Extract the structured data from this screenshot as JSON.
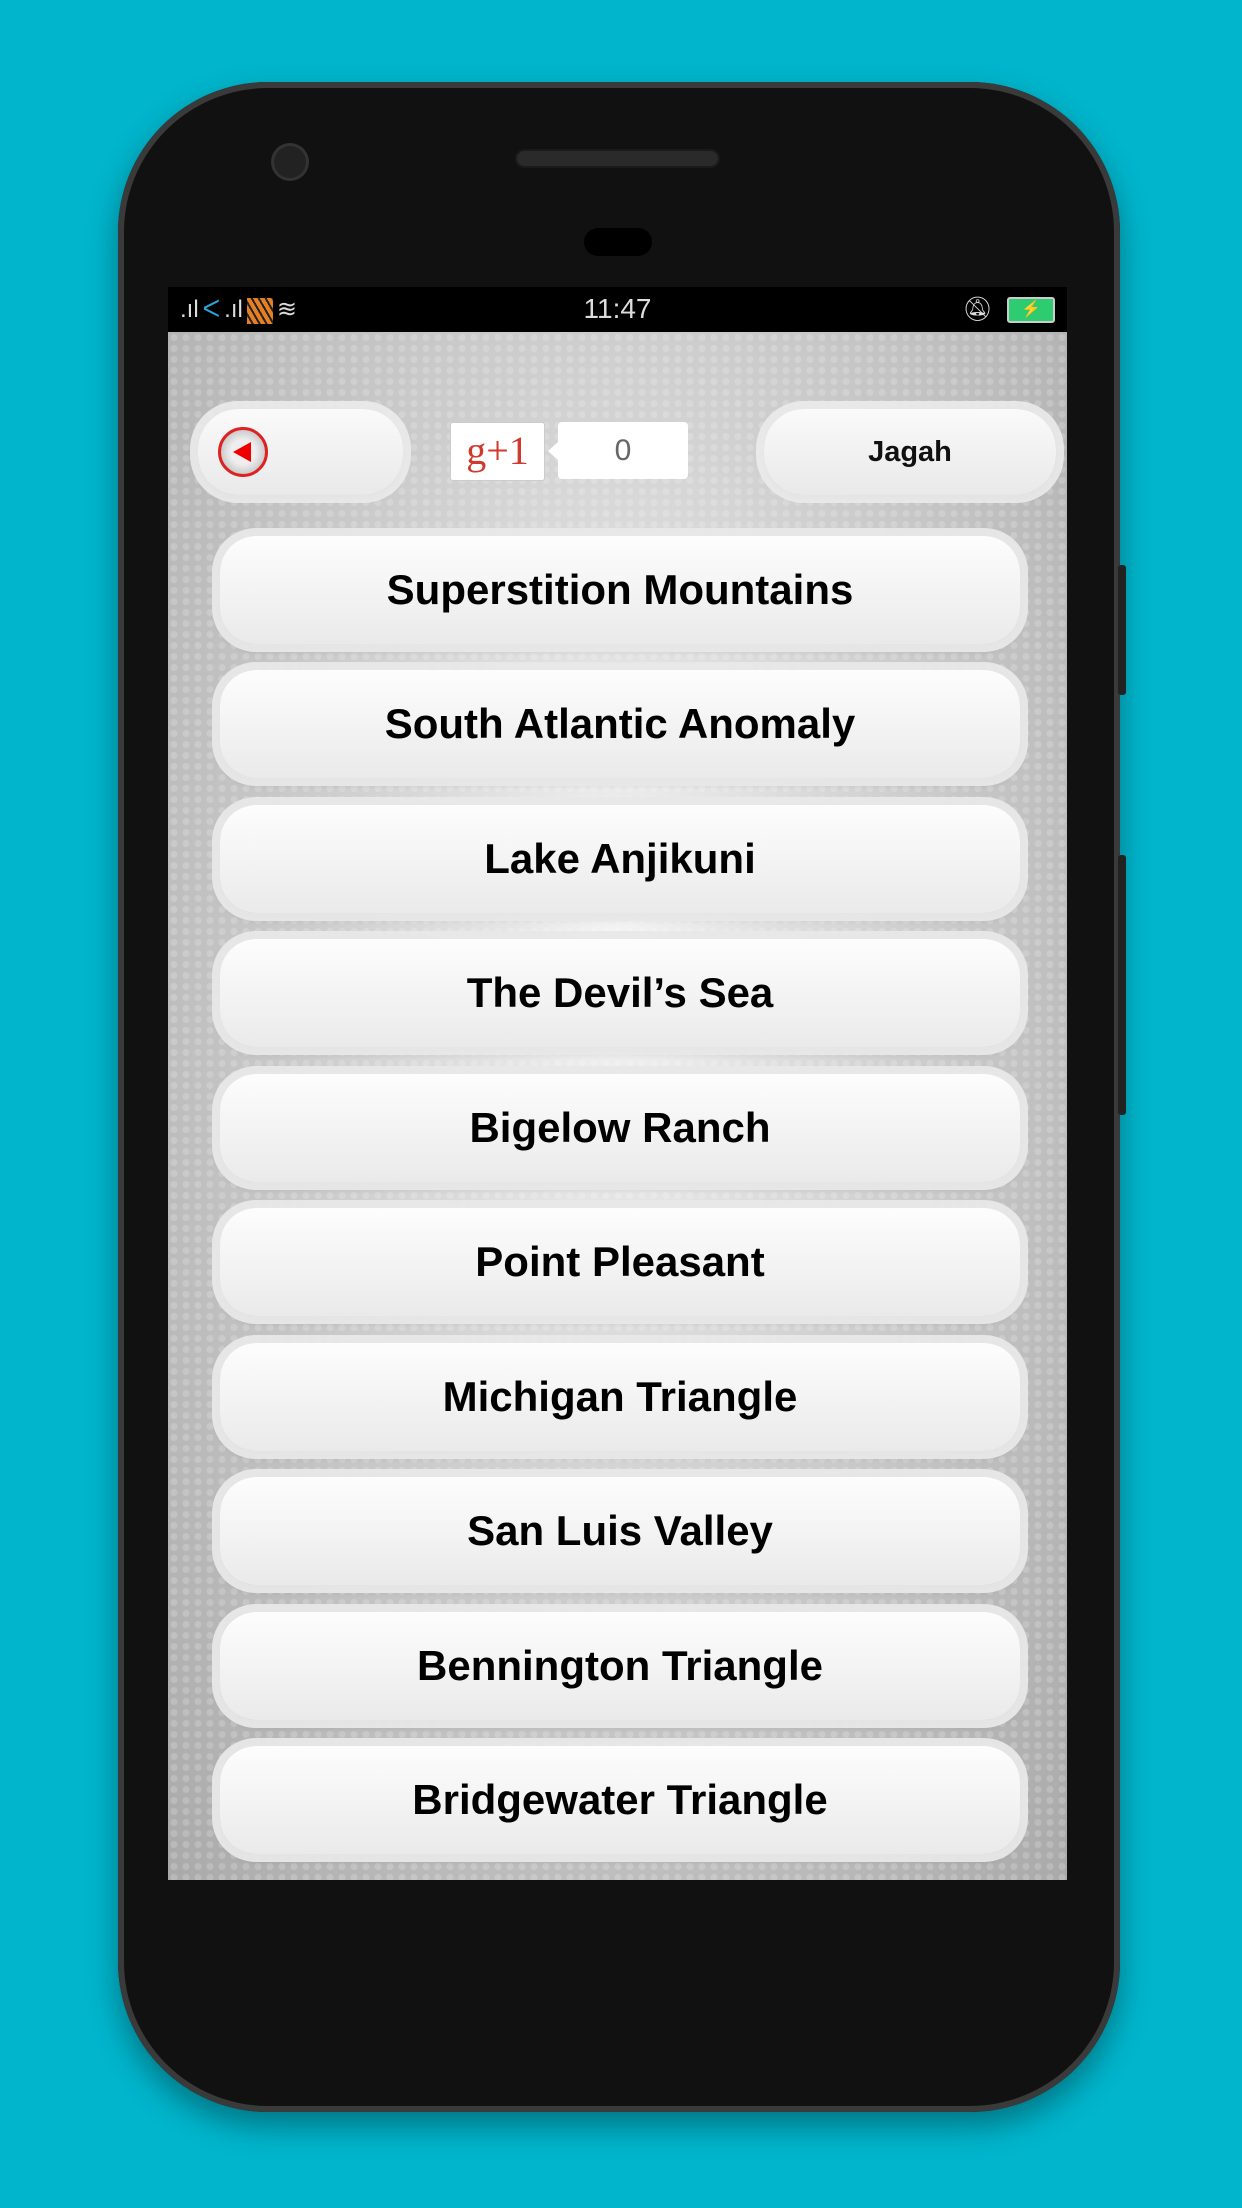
{
  "status_bar": {
    "time": "11:47",
    "icons": [
      "signal-icon",
      "carrier-icon",
      "signal-icon",
      "carrier-icon",
      "wifi-icon",
      "bell-off-icon",
      "battery-charging-icon"
    ]
  },
  "header": {
    "back_icon": "back-arrow-icon",
    "gplus_label": "g+1",
    "gplus_count": "0",
    "jagah_label": "Jagah"
  },
  "list": {
    "items": [
      {
        "label": "Superstition Mountains"
      },
      {
        "label": "South Atlantic Anomaly"
      },
      {
        "label": "Lake Anjikuni"
      },
      {
        "label": "The Devil’s Sea"
      },
      {
        "label": "Bigelow Ranch"
      },
      {
        "label": "Point Pleasant"
      },
      {
        "label": "Michigan Triangle"
      },
      {
        "label": "San Luis Valley"
      },
      {
        "label": "Bennington Triangle"
      },
      {
        "label": "Bridgewater Triangle"
      }
    ]
  },
  "colors": {
    "background": "#00b5cc",
    "gplus_red": "#d0392b",
    "battery_green": "#2ecc71"
  }
}
